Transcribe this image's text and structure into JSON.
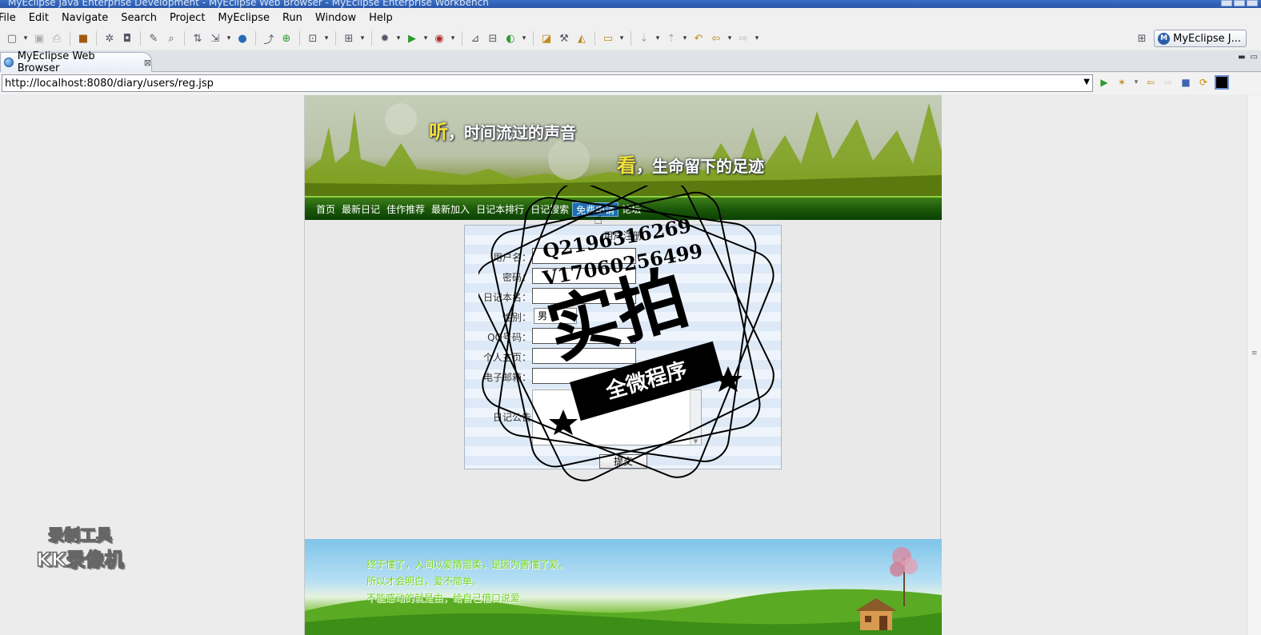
{
  "window": {
    "title": "MyEclipse Java Enterprise Development - MyEclipse Web Browser - MyEclipse Enterprise Workbench"
  },
  "menu": [
    "File",
    "Edit",
    "Navigate",
    "Search",
    "Project",
    "MyEclipse",
    "Run",
    "Window",
    "Help"
  ],
  "perspective": {
    "label": "MyEclipse J..."
  },
  "tab": {
    "title": "MyEclipse Web Browser"
  },
  "url": {
    "value": "http://localhost:8080/diary/users/reg.jsp"
  },
  "site": {
    "slogan1_hl": "听",
    "slogan1_rest": "，时间流过的声音",
    "slogan2_hl": "看",
    "slogan2_rest": "，生命留下的足迹",
    "nav": [
      "首页",
      "最新日记",
      "佳作推荐",
      "最新加入",
      "日记本排行",
      "日记搜索",
      "免费申请",
      "论坛"
    ],
    "nav_active_index": 6,
    "form": {
      "title": "用户注册",
      "fields": {
        "username": "用户名：",
        "password": "密码：",
        "diary_name": "日记本名：",
        "gender": "性别：",
        "qq": "QQ号码：",
        "homepage": "个人主页：",
        "email": "电子邮箱：",
        "notice": "日记公告"
      },
      "gender_selected": "男",
      "submit": "提交"
    },
    "footer": {
      "line1": "终于懂了，人间以爱情温柔，是因为善懂了爱。",
      "line2": "所以才会明白，爱不简单。",
      "line3": "不能感动的就是由，给自己借口说爱"
    }
  },
  "overlay": {
    "recorder_line1": "录制工具",
    "recorder_line2": "KK录像机",
    "watermark_qq": "Q2196316269",
    "watermark_v": "V17060256499",
    "watermark_big": "实拍",
    "watermark_ribbon": "全微程序"
  }
}
